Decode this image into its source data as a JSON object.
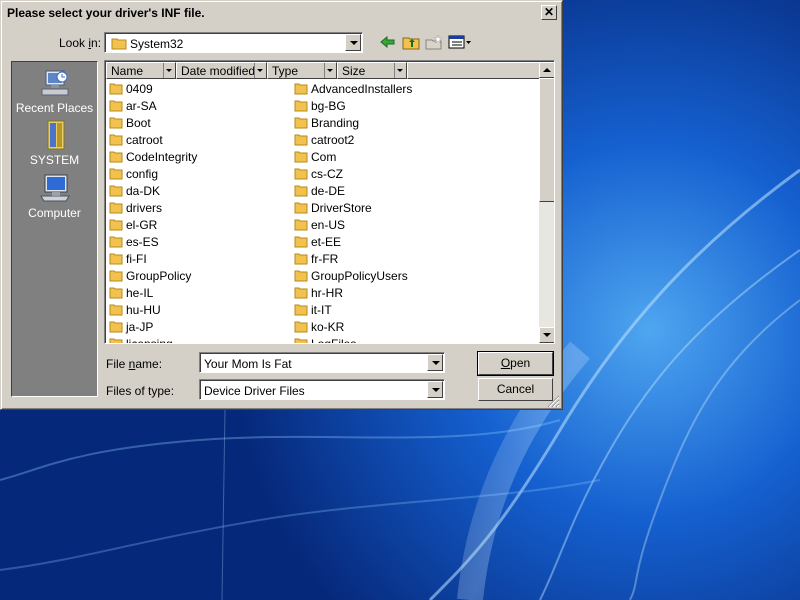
{
  "dialog": {
    "title": "Please select your driver's INF file.",
    "close_label": "✕"
  },
  "lookin": {
    "label_pre": "Look ",
    "label_accel": "i",
    "label_post": "n:",
    "value": "System32"
  },
  "toolbar": {
    "icons": [
      "back-icon",
      "up-folder-icon",
      "new-folder-icon",
      "view-menu-icon"
    ]
  },
  "places": [
    {
      "label": "Recent Places",
      "icon": "recent-places-icon"
    },
    {
      "label": "SYSTEM",
      "icon": "user-folder-icon"
    },
    {
      "label": "Computer",
      "icon": "computer-icon"
    }
  ],
  "columns": [
    "Name",
    "Date modified",
    "Type",
    "Size"
  ],
  "files_left": [
    "0409",
    "ar-SA",
    "Boot",
    "catroot",
    "CodeIntegrity",
    "config",
    "da-DK",
    "drivers",
    "el-GR",
    "es-ES",
    "fi-FI",
    "GroupPolicy",
    "he-IL",
    "hu-HU",
    "ja-JP",
    "licensing"
  ],
  "files_right": [
    "AdvancedInstallers",
    "bg-BG",
    "Branding",
    "catroot2",
    "Com",
    "cs-CZ",
    "de-DE",
    "DriverStore",
    "en-US",
    "et-EE",
    "fr-FR",
    "GroupPolicyUsers",
    "hr-HR",
    "it-IT",
    "ko-KR",
    "LogFiles"
  ],
  "filename": {
    "label_pre": "File ",
    "label_accel": "n",
    "label_post": "ame:",
    "value": "Your Mom Is Fat"
  },
  "filetype": {
    "label": "Files of type:",
    "value": "Device Driver Files"
  },
  "buttons": {
    "open_accel": "O",
    "open_rest": "pen",
    "cancel": "Cancel"
  },
  "colors": {
    "dialog_bg": "#d4d0c8",
    "folder": "#f2c14e",
    "desktop": "#0a3fae"
  }
}
